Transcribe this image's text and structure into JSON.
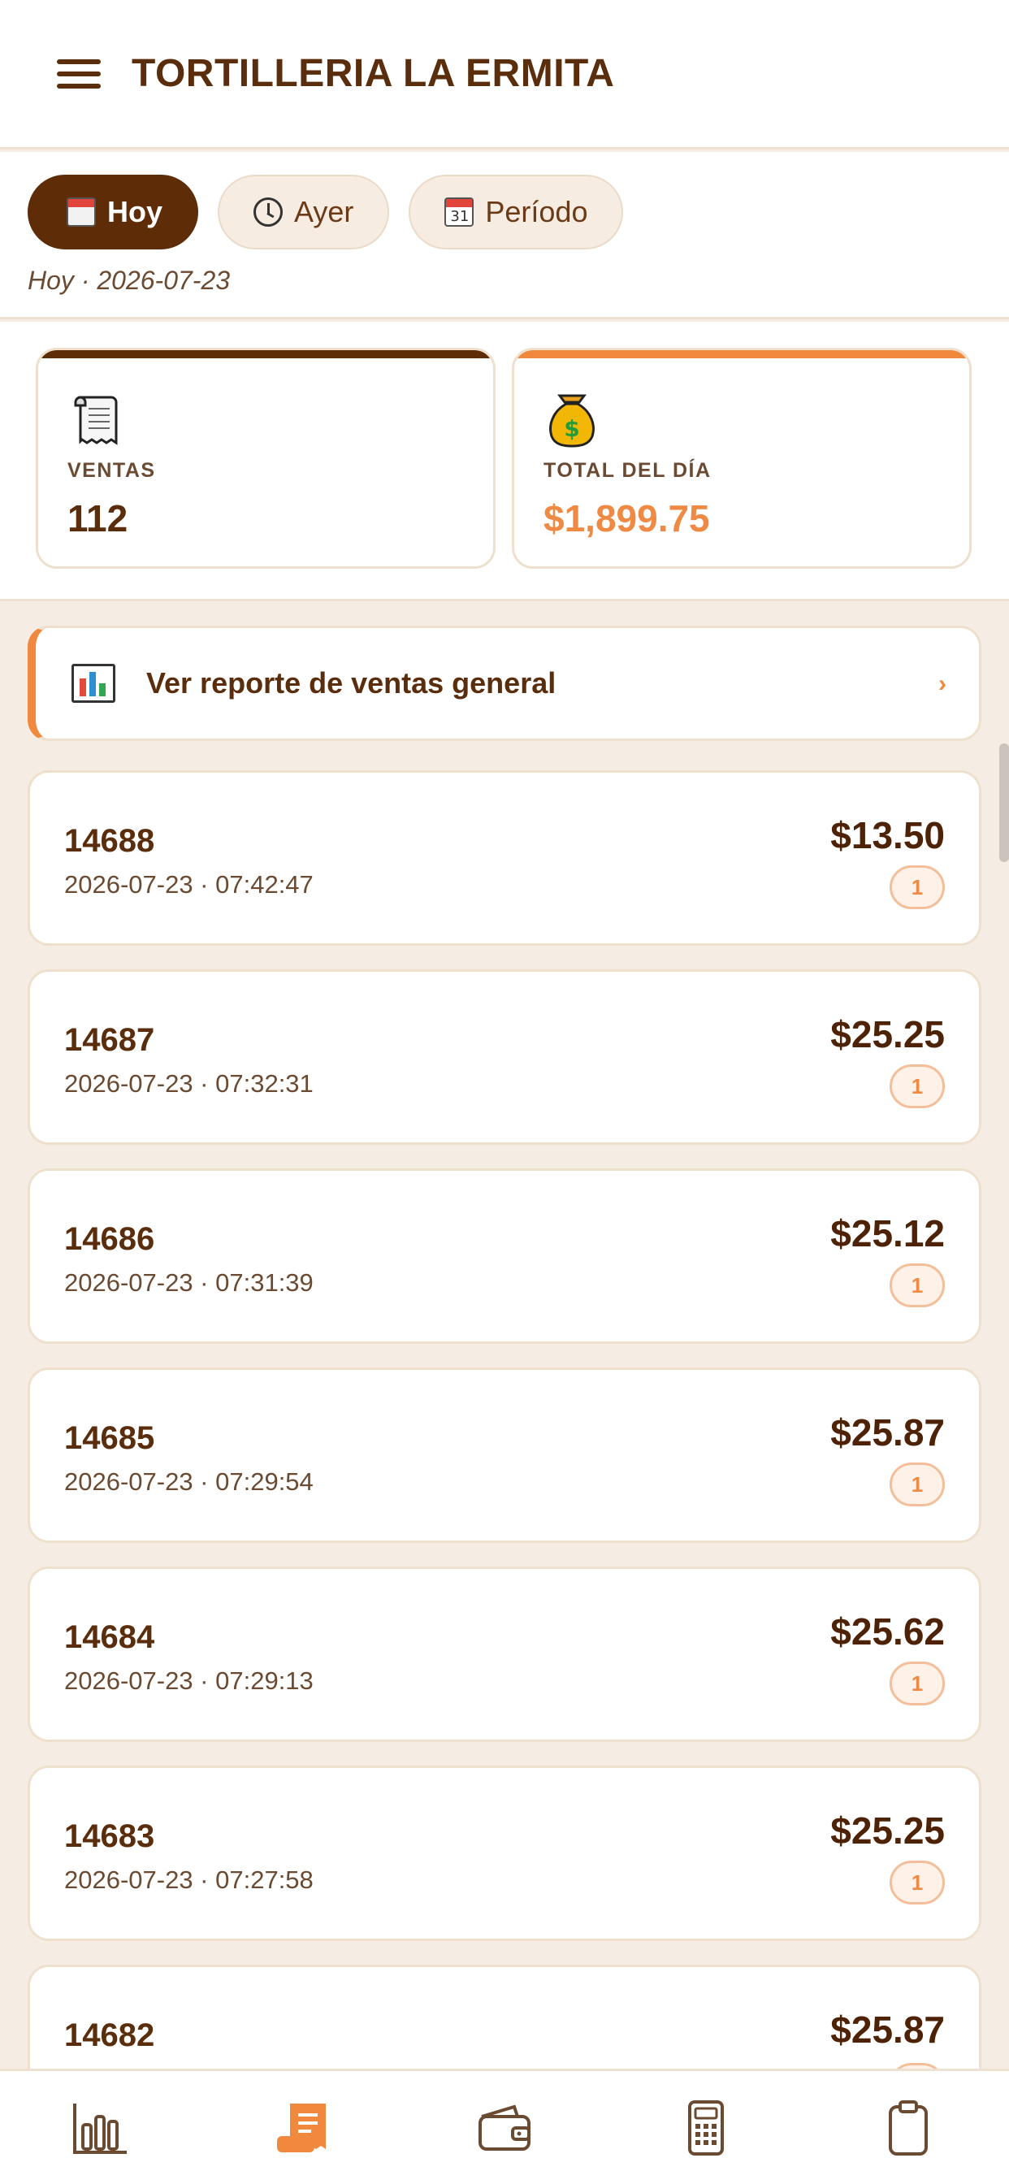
{
  "header": {
    "title": "TORTILLERIA LA ERMITA",
    "menu_icon": "hamburger-menu-icon"
  },
  "filters": {
    "chips": [
      {
        "label": "Hoy",
        "icon": "calendar-icon",
        "active": true
      },
      {
        "label": "Ayer",
        "icon": "clock-icon",
        "active": false
      },
      {
        "label": "Período",
        "icon": "calendar-31-icon",
        "active": false
      }
    ],
    "period_label": "Hoy · 2026-07-23"
  },
  "stats": {
    "sales": {
      "label": "VENTAS",
      "value": "112",
      "icon": "receipt-icon"
    },
    "total": {
      "label": "TOTAL DEL DÍA",
      "value": "$1,899.75",
      "icon": "money-bag-icon"
    }
  },
  "report": {
    "label": "Ver reporte de ventas general",
    "icon": "bar-chart-icon",
    "chevron": "›"
  },
  "sales": [
    {
      "id": "14688",
      "datetime": "2026-07-23 · 07:42:47",
      "amount": "$13.50",
      "items": "1"
    },
    {
      "id": "14687",
      "datetime": "2026-07-23 · 07:32:31",
      "amount": "$25.25",
      "items": "1"
    },
    {
      "id": "14686",
      "datetime": "2026-07-23 · 07:31:39",
      "amount": "$25.12",
      "items": "1"
    },
    {
      "id": "14685",
      "datetime": "2026-07-23 · 07:29:54",
      "amount": "$25.87",
      "items": "1"
    },
    {
      "id": "14684",
      "datetime": "2026-07-23 · 07:29:13",
      "amount": "$25.62",
      "items": "1"
    },
    {
      "id": "14683",
      "datetime": "2026-07-23 · 07:27:58",
      "amount": "$25.25",
      "items": "1"
    },
    {
      "id": "14682",
      "datetime": "",
      "amount": "$25.87",
      "items": ""
    }
  ],
  "nav": [
    {
      "icon": "bar-chart-icon",
      "active": false
    },
    {
      "icon": "receipt-icon",
      "active": true
    },
    {
      "icon": "wallet-icon",
      "active": false
    },
    {
      "icon": "calculator-icon",
      "active": false
    },
    {
      "icon": "clipboard-icon",
      "active": false
    }
  ],
  "colors": {
    "brown": "#5e2c07",
    "orange": "#f0893e",
    "background": "#f5ede3"
  }
}
